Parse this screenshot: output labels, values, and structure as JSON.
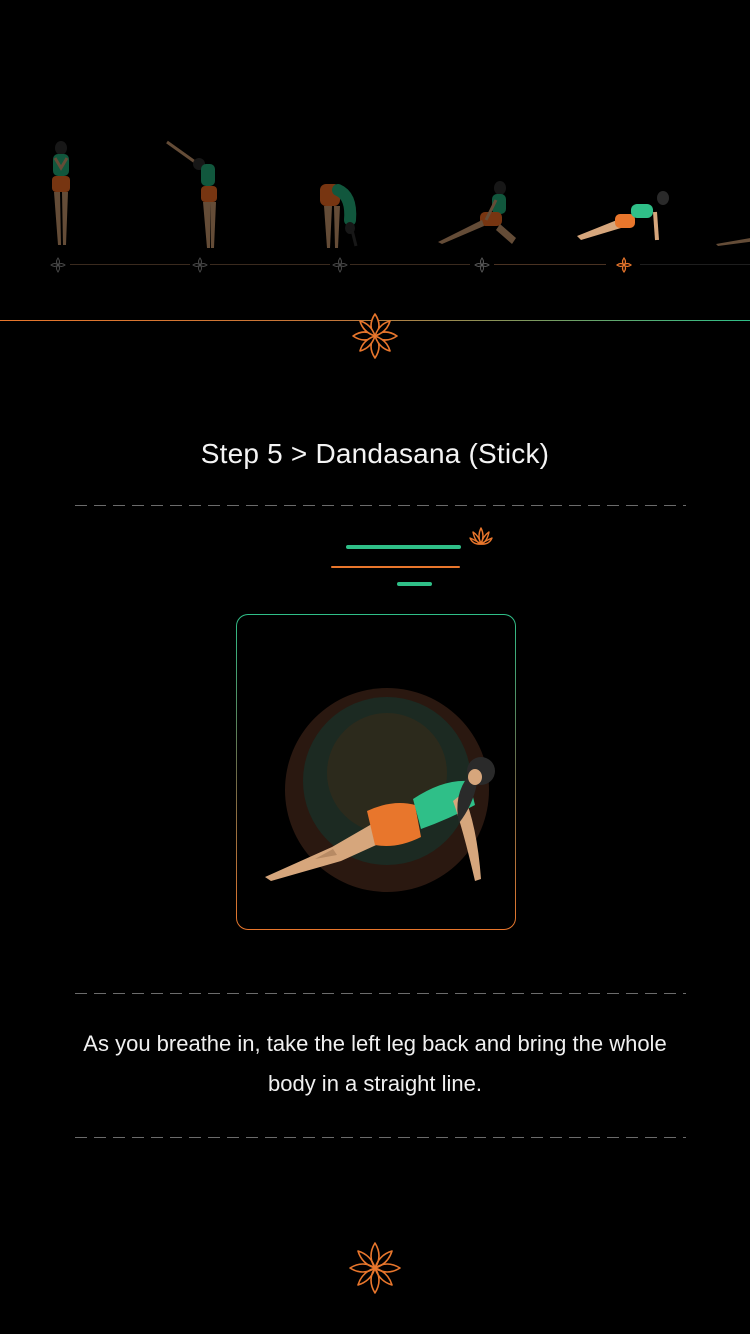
{
  "sequence": {
    "poses": [
      {
        "name": "pose-pranamasana",
        "state": "done"
      },
      {
        "name": "pose-hasta-uttanasana",
        "state": "done"
      },
      {
        "name": "pose-hastapadasana",
        "state": "done"
      },
      {
        "name": "pose-ashwa-sanchalanasana",
        "state": "done"
      },
      {
        "name": "pose-dandasana",
        "state": "current"
      },
      {
        "name": "pose-next",
        "state": "upcoming"
      }
    ],
    "node_icon": "lotus-outline-icon"
  },
  "step": {
    "title": "Step 5 > Dandasana (Stick)",
    "instruction": "As you breathe in, take the left leg back and bring the whole body in a straight line."
  },
  "colors": {
    "background": "#000000",
    "accent_orange": "#e8762c",
    "accent_green": "#2fbf88",
    "skin": "#d6a67c",
    "dash": "#6b6b6b"
  },
  "icons": {
    "top": "lotus-flower-icon",
    "small": "lotus-icon",
    "bottom": "lotus-flower-icon"
  }
}
